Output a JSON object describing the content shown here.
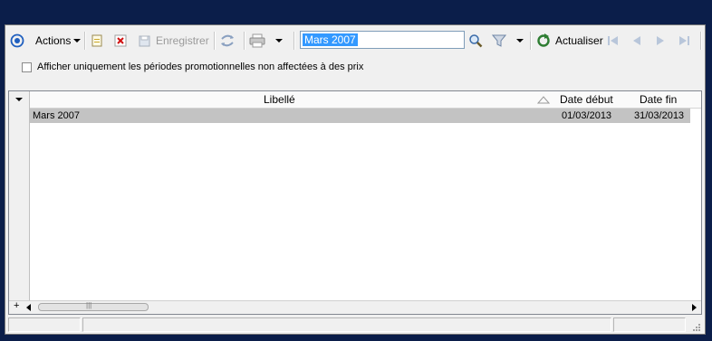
{
  "toolbar": {
    "actions_label": "Actions",
    "save_label": "Enregistrer",
    "search_value": "Mars 2007",
    "refresh_label": "Actualiser"
  },
  "filter": {
    "checkbox_label": "Afficher uniquement les périodes promotionnelles non affectées à des prix",
    "checked": false
  },
  "grid": {
    "columns": [
      "Libellé",
      "Date début",
      "Date fin"
    ],
    "rows": [
      {
        "libelle": "Mars 2007",
        "date_debut": "01/03/2013",
        "date_fin": "31/03/2013"
      }
    ]
  },
  "colors": {
    "background": "#0b1e4a",
    "selection": "#3399ff",
    "row_selected": "#c3c3c3"
  },
  "icons": [
    "navigation-circle-icon",
    "new-document-icon",
    "delete-icon",
    "save-icon",
    "sync-icon",
    "print-icon",
    "search-icon",
    "filter-icon",
    "refresh-icon",
    "first-icon",
    "previous-icon",
    "next-icon",
    "last-icon"
  ]
}
